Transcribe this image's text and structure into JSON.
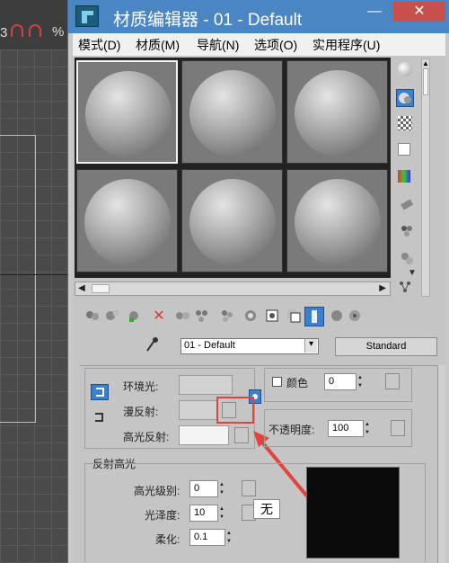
{
  "viewport_header": {
    "num": "3",
    "pct": "%"
  },
  "window": {
    "title": "材质编辑器 - 01 - Default",
    "minimize": "—",
    "close": "✕"
  },
  "menu": [
    "模式(D)",
    "材质(M)",
    "导航(N)",
    "选项(O)",
    "实用程序(U)"
  ],
  "toolbar": {
    "material_name": "01 - Default",
    "material_type": "Standard"
  },
  "basic": {
    "ambient": "环境光:",
    "diffuse": "漫反射:",
    "specular": "高光反射:",
    "self_illum": "颜色",
    "self_illum_value": "0",
    "opacity": "不透明度:",
    "opacity_value": "100"
  },
  "specular_highlights": {
    "group": "反射高光",
    "level": "高光级别:",
    "level_value": "0",
    "glossiness": "光泽度:",
    "glossiness_value": "10",
    "soften": "柔化:",
    "soften_value": "0.1",
    "tooltip": "无"
  },
  "icons": {
    "arrow_left": "◀",
    "arrow_right": "▶",
    "arrow_up": "▲",
    "arrow_down": "▼",
    "dropdown": "▾"
  },
  "colors": {
    "titlebar": "#4b86c4",
    "highlight": "#e0443d",
    "arrow": "#e0443d"
  }
}
